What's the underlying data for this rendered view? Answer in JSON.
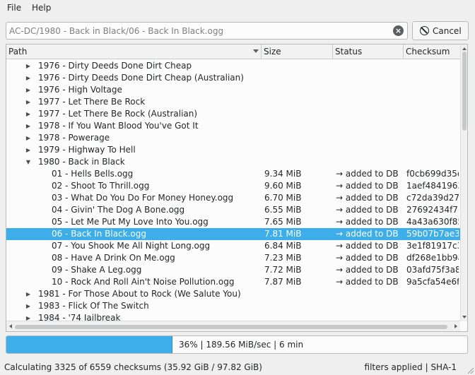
{
  "menu": {
    "file": "File",
    "help": "Help"
  },
  "path_field": {
    "value": "AC-DC/1980 - Back in Black/06 - Back In Black.ogg"
  },
  "cancel_button": {
    "label": "Cancel"
  },
  "columns": [
    "Path",
    "Size",
    "Status",
    "Checksum"
  ],
  "rows": [
    {
      "indent": 1,
      "expander": "collapsed",
      "path": "1976 - Dirty Deeds Done Dirt Cheap",
      "size": "",
      "status": "",
      "checksum": ""
    },
    {
      "indent": 1,
      "expander": "collapsed",
      "path": "1976 - Dirty Deeds Done Dirt Cheap (Australian)",
      "size": "",
      "status": "",
      "checksum": ""
    },
    {
      "indent": 1,
      "expander": "collapsed",
      "path": "1976 - High Voltage",
      "size": "",
      "status": "",
      "checksum": ""
    },
    {
      "indent": 1,
      "expander": "collapsed",
      "path": "1977 - Let There Be Rock",
      "size": "",
      "status": "",
      "checksum": ""
    },
    {
      "indent": 1,
      "expander": "collapsed",
      "path": "1977 - Let There Be Rock (Australian)",
      "size": "",
      "status": "",
      "checksum": ""
    },
    {
      "indent": 1,
      "expander": "collapsed",
      "path": "1978 - If You Want Blood You've Got It",
      "size": "",
      "status": "",
      "checksum": ""
    },
    {
      "indent": 1,
      "expander": "collapsed",
      "path": "1978 - Powerage",
      "size": "",
      "status": "",
      "checksum": ""
    },
    {
      "indent": 1,
      "expander": "collapsed",
      "path": "1979 - Highway To Hell",
      "size": "",
      "status": "",
      "checksum": ""
    },
    {
      "indent": 1,
      "expander": "expanded",
      "path": "1980 - Back in Black",
      "size": "",
      "status": "",
      "checksum": ""
    },
    {
      "indent": 2,
      "expander": "",
      "path": "01 - Hells Bells.ogg",
      "size": "9.34 MiB",
      "status": "→ added to DB",
      "checksum": "f0cb699d35e:"
    },
    {
      "indent": 2,
      "expander": "",
      "path": "02 - Shoot To Thrill.ogg",
      "size": "9.60 MiB",
      "status": "→ added to DB",
      "checksum": "1aef48419636"
    },
    {
      "indent": 2,
      "expander": "",
      "path": "03 - What Do You Do For Money Honey.ogg",
      "size": "6.70 MiB",
      "status": "→ added to DB",
      "checksum": "c72da39d271"
    },
    {
      "indent": 2,
      "expander": "",
      "path": "04 - Givin' The Dog A Bone.ogg",
      "size": "6.55 MiB",
      "status": "→ added to DB",
      "checksum": "27692434f76"
    },
    {
      "indent": 2,
      "expander": "",
      "path": "05 - Let Me Put My Love Into You.ogg",
      "size": "7.65 MiB",
      "status": "→ added to DB",
      "checksum": "4a43a630f859"
    },
    {
      "indent": 2,
      "expander": "",
      "path": "06 - Back In Black.ogg",
      "size": "7.81 MiB",
      "status": "→ added to DB",
      "checksum": "59b07b7ae37",
      "selected": true
    },
    {
      "indent": 2,
      "expander": "",
      "path": "07 - You Shook Me All Night Long.ogg",
      "size": "6.84 MiB",
      "status": "→ added to DB",
      "checksum": "3e1f81917c34"
    },
    {
      "indent": 2,
      "expander": "",
      "path": "08 - Have A Drink On Me.ogg",
      "size": "7.23 MiB",
      "status": "→ added to DB",
      "checksum": "df268e1bb9a"
    },
    {
      "indent": 2,
      "expander": "",
      "path": "09 - Shake A Leg.ogg",
      "size": "7.72 MiB",
      "status": "→ added to DB",
      "checksum": "03afd75f3a80"
    },
    {
      "indent": 2,
      "expander": "",
      "path": "10 - Rock And Roll Ain't Noise Pollution.ogg",
      "size": "7.87 MiB",
      "status": "→ added to DB",
      "checksum": "9a5cfa54e6f2"
    },
    {
      "indent": 1,
      "expander": "collapsed",
      "path": "1981 - For Those About to Rock (We Salute You)",
      "size": "",
      "status": "",
      "checksum": ""
    },
    {
      "indent": 1,
      "expander": "collapsed",
      "path": "1983 - Flick Of The Switch",
      "size": "",
      "status": "",
      "checksum": ""
    },
    {
      "indent": 1,
      "expander": "collapsed",
      "path": "1984 - '74 Jailbreak",
      "size": "",
      "status": "",
      "checksum": ""
    }
  ],
  "progress": {
    "percent": 36,
    "text": "36% | 189.56 MiB/sec | 6 min"
  },
  "status": {
    "left": "Calculating 3325 of 6559 checksums (35.92 GiB / 97.82 GiB)",
    "right": "filters applied | SHA-1"
  },
  "colors": {
    "accent": "#3daee9",
    "window": "#efefef",
    "text": "#232627"
  }
}
